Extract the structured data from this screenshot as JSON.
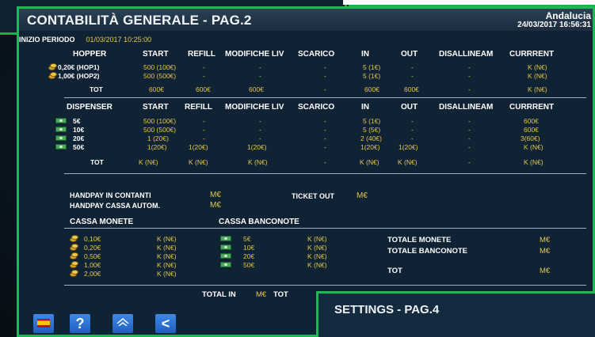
{
  "header": {
    "title": "CONTABILITÀ GENERALE - PAG.2",
    "region": "Andalucia",
    "datetime": "24/03/2017 16:56:31"
  },
  "period": {
    "label": "INIZIO PERIODO",
    "value": "01/03/2017 10:25:00"
  },
  "hopper": {
    "columns": [
      "HOPPER",
      "START",
      "REFILL",
      "MODIFICHE LIV",
      "SCARICO",
      "IN",
      "OUT",
      "DISALLINEAM",
      "CURRRENT"
    ],
    "rows": [
      {
        "name": "0,20€ (HOP1)",
        "start": "500 (100€)",
        "refill": "-",
        "mod": "-",
        "scarico": "-",
        "in": "5 (1€)",
        "out": "-",
        "dis": "-",
        "current": "K (N€)"
      },
      {
        "name": "1,00€ (HOP2)",
        "start": "500 (500€)",
        "refill": "-",
        "mod": "-",
        "scarico": "-",
        "in": "5 (1€)",
        "out": "-",
        "dis": "-",
        "current": "K (N€)"
      }
    ],
    "tot": {
      "label": "TOT",
      "start": "600€",
      "refill": "600€",
      "mod": "600€",
      "scarico": "-",
      "in": "600€",
      "out": "600€",
      "dis": "-",
      "current": "K (N€)"
    }
  },
  "dispenser": {
    "columns": [
      "DISPENSER",
      "START",
      "REFILL",
      "MODIFICHE LIV",
      "SCARICO",
      "IN",
      "OUT",
      "DISALLINEAM",
      "CURRRENT"
    ],
    "rows": [
      {
        "name": "5€",
        "start": "500 (100€)",
        "refill": "-",
        "mod": "-",
        "scarico": "-",
        "in": "5 (1€)",
        "out": "-",
        "dis": "-",
        "current": "600€"
      },
      {
        "name": "10€",
        "start": "500 (500€)",
        "refill": "-",
        "mod": "-",
        "scarico": "-",
        "in": "5 (5€)",
        "out": "-",
        "dis": "-",
        "current": "600€"
      },
      {
        "name": "20€",
        "start": "1 (20€)",
        "refill": "-",
        "mod": "-",
        "scarico": "-",
        "in": "2 (40€)",
        "out": "-",
        "dis": "-",
        "current": "3(60€)"
      },
      {
        "name": "50€",
        "start": "1(20€)",
        "refill": "1(20€)",
        "mod": "1(20€)",
        "scarico": "-",
        "in": "1(20€)",
        "out": "1(20€)",
        "dis": "-",
        "current": "K (N€)"
      }
    ],
    "tot": {
      "label": "TOT",
      "start": "K (N€)",
      "refill": "K (N€)",
      "mod": "K (N€)",
      "scarico": "-",
      "in": "K (N€)",
      "out": "K (N€)",
      "dis": "-",
      "current": "K (N€)"
    }
  },
  "handpay": {
    "contanti_label": "HANDPAY IN CONTANTI",
    "contanti_value": "M€",
    "autom_label": "HANDPAY CASSA AUTOM.",
    "autom_value": "M€",
    "ticket_out_label": "TICKET OUT",
    "ticket_out_value": "M€"
  },
  "cassa_monete": {
    "title": "CASSA MONETE",
    "rows": [
      {
        "name": "0,10€",
        "value": "K (N€)"
      },
      {
        "name": "0,20€",
        "value": "K (N€)"
      },
      {
        "name": "0,50€",
        "value": "K (N€)"
      },
      {
        "name": "1,00€",
        "value": "K (N€)"
      },
      {
        "name": "2,00€",
        "value": "K (N€)"
      }
    ]
  },
  "cassa_banconote": {
    "title": "CASSA BANCONOTE",
    "rows": [
      {
        "name": "5€",
        "value": "K (N€)"
      },
      {
        "name": "10€",
        "value": "K (N€)"
      },
      {
        "name": "20€",
        "value": "K (N€)"
      },
      {
        "name": "50€",
        "value": "K (N€)"
      }
    ]
  },
  "totals": {
    "monete_label": "TOTALE MONETE",
    "monete_value": "M€",
    "banconote_label": "TOTALE BANCONOTE",
    "banconote_value": "M€",
    "tot_label": "TOT",
    "tot_value": "M€",
    "total_in_label": "TOTAL IN",
    "total_in_value": "M€",
    "total_out_label": "TOT"
  },
  "footer": {
    "help": "?",
    "back": "<"
  },
  "settings": {
    "title": "SETTINGS - PAG.4"
  },
  "colors": {
    "accent": "#1db954",
    "value": "#e5c54a",
    "button": "#2a72d8"
  }
}
